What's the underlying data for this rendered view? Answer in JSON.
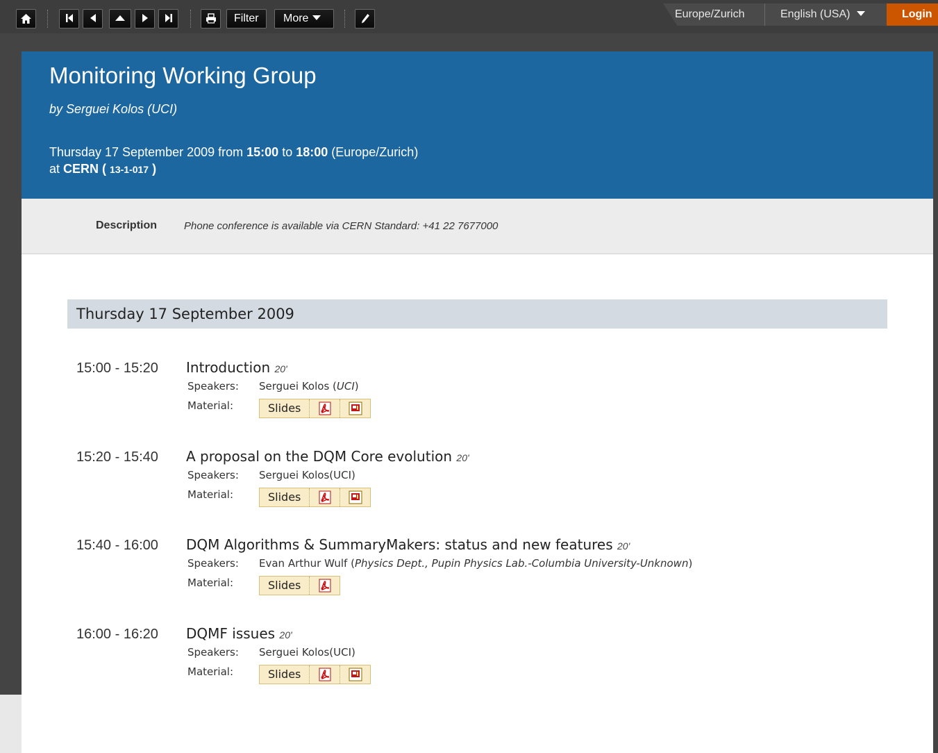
{
  "toolbar": {
    "filter_label": "Filter",
    "more_label": "More",
    "timezone": "Europe/Zurich",
    "language": "English (USA)",
    "login_label": "Login"
  },
  "event": {
    "title": "Monitoring Working Group",
    "chair": "by Serguei Kolos (UCI)",
    "date_prefix": "Thursday 17 September 2009 from ",
    "start": "15:00",
    "to": " to ",
    "end": "18:00",
    "tz_suffix": " (Europe/Zurich)",
    "at": "at ",
    "location": "CERN",
    "room_open": " ( ",
    "room": "13-1-017",
    "room_close": " )"
  },
  "description": {
    "label": "Description",
    "text": "Phone conference is available via CERN Standard: +41 22 7677000"
  },
  "day": {
    "title": "Thursday 17 September 2009"
  },
  "contributions": [
    {
      "time": "15:00 - 15:20",
      "title": "Introduction",
      "duration": "20'",
      "speakers_label": "Speakers:",
      "speaker": "Serguei Kolos (",
      "speaker_aff": "UCI",
      "speaker_close": ")",
      "material_label": "Material:",
      "material": "Slides"
    },
    {
      "time": "15:20 - 15:40",
      "title": "A proposal on the DQM Core evolution",
      "duration": "20'",
      "speakers_label": "Speakers:",
      "speaker": "Serguei Kolos(UCI)",
      "material_label": "Material:",
      "material": "Slides"
    },
    {
      "time": "15:40 - 16:00",
      "title": "DQM Algorithms & SummaryMakers: status and new features",
      "duration": "20'",
      "speakers_label": "Speakers:",
      "speaker": "Evan Arthur Wulf (",
      "speaker_aff": "Physics Dept., Pupin Physics Lab.-Columbia University-Unknown",
      "speaker_close": ")",
      "material_label": "Material:",
      "material": "Slides"
    },
    {
      "time": "16:00 - 16:20",
      "title": "DQMF issues",
      "duration": "20'",
      "speakers_label": "Speakers:",
      "speaker": "Serguei Kolos(UCI)",
      "material_label": "Material:",
      "material": "Slides"
    }
  ],
  "icons": {
    "home": "home-icon",
    "first": "first-icon",
    "previous": "previous-icon",
    "up": "up-icon",
    "next": "next-icon",
    "last": "last-icon",
    "print": "print-icon",
    "edit": "pencil-icon",
    "pdf": "pdf-icon",
    "ppt": "ppt-icon"
  },
  "colors": {
    "header_bg": "#1d67a0",
    "login_bg": "#cc5500",
    "day_bar_bg": "#d3dae1",
    "material_bg": "#f9ecc8"
  }
}
